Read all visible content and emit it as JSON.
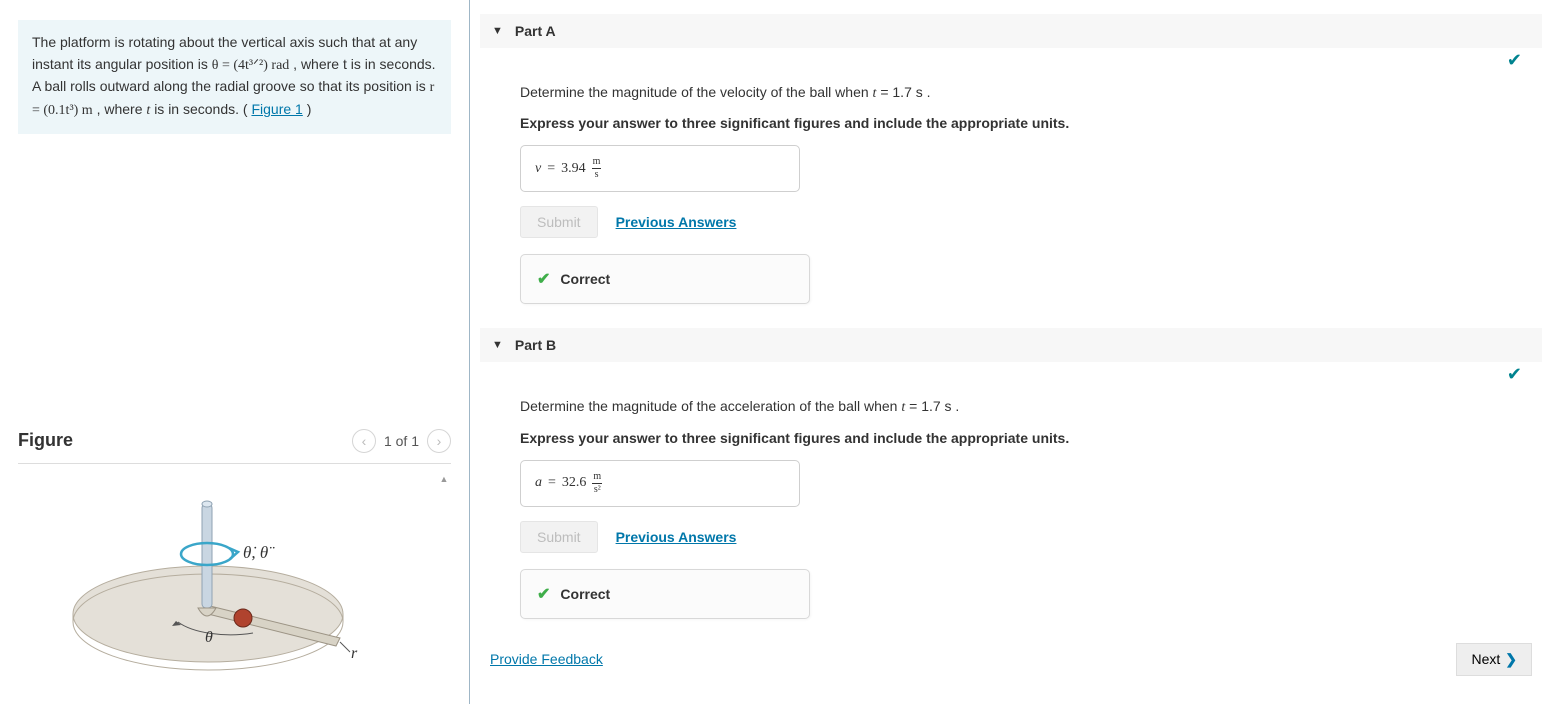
{
  "problem": {
    "pre": "The platform is rotating about the vertical axis such that at any instant its angular position is ",
    "theta_eq": "θ = (4t³ᐟ²) rad",
    "mid1": ", where t is in seconds. A ball rolls outward along the radial groove so that its position is ",
    "r_eq": "r = (0.1t³) m",
    "mid2": ", where ",
    "tvar": "t",
    "post": " is in seconds. (",
    "fig_link": "Figure 1",
    "close": ")"
  },
  "figure": {
    "heading": "Figure",
    "pager": "1 of 1",
    "labels": {
      "theta_dot": "θ̇, θ̈",
      "theta": "θ",
      "r": "r"
    }
  },
  "parts": {
    "a": {
      "title": "Part A",
      "question_pre": "Determine the magnitude of the velocity of the ball when ",
      "tvar": "t",
      "question_post": " = 1.7 s .",
      "instruction": "Express your answer to three significant figures and include the appropriate units.",
      "ans_symbol": "v",
      "ans_equals": " = ",
      "ans_value": "3.94",
      "ans_unit_num": "m",
      "ans_unit_den": "s",
      "submit": "Submit",
      "prev": "Previous Answers",
      "feedback": "Correct"
    },
    "b": {
      "title": "Part B",
      "question_pre": "Determine the magnitude of the acceleration of the ball when ",
      "tvar": "t",
      "question_post": " = 1.7 s .",
      "instruction": "Express your answer to three significant figures and include the appropriate units.",
      "ans_symbol": "a",
      "ans_equals": " = ",
      "ans_value": "32.6",
      "ans_unit_num": "m",
      "ans_unit_den": "s²",
      "submit": "Submit",
      "prev": "Previous Answers",
      "feedback": "Correct"
    }
  },
  "footer": {
    "provide": "Provide Feedback",
    "next": "Next"
  }
}
